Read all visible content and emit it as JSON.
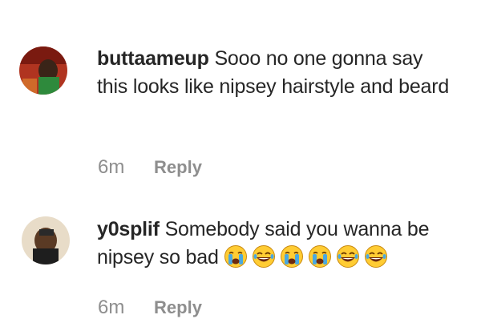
{
  "comments": [
    {
      "username": "buttaameup",
      "text": "Sooo no one gonna say this looks like nipsey hairstyle and beard",
      "time": "6m",
      "reply_label": "Reply",
      "avatar": "profile-photo-red-background"
    },
    {
      "username": "y0splif",
      "text": "Somebody said you wanna be nipsey so bad",
      "emojis": [
        "crying-face-emoji",
        "tears-of-joy-emoji",
        "crying-face-emoji",
        "crying-face-emoji",
        "tears-of-joy-emoji",
        "tears-of-joy-emoji"
      ],
      "time": "6m",
      "reply_label": "Reply",
      "avatar": "profile-photo-beige-background"
    }
  ],
  "colors": {
    "text": "#262626",
    "secondary": "#8e8e8e",
    "emoji_face": "#ffcc33",
    "emoji_tear": "#4aa8e0"
  }
}
